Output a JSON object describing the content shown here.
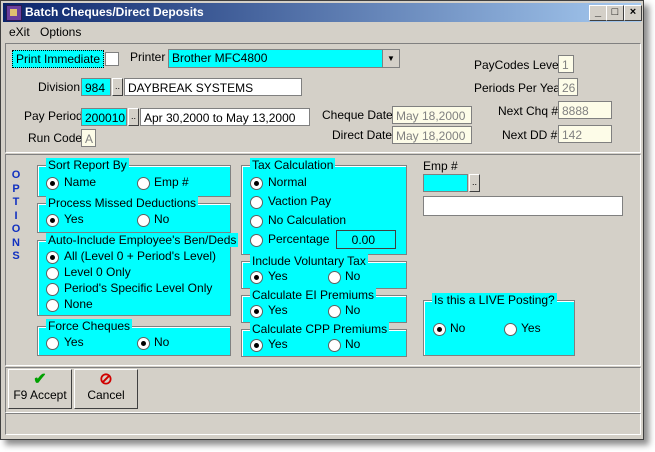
{
  "window": {
    "title": "Batch Cheques/Direct Deposits"
  },
  "menu": [
    "eXit",
    "Options"
  ],
  "top": {
    "print_immediate_label": "Print Immediate",
    "printer_label": "Printer",
    "printer_value": "Brother MFC4800",
    "division_label": "Division",
    "division_code": "984",
    "division_name": "DAYBREAK SYSTEMS",
    "pay_period_label": "Pay Period",
    "pay_period_code": "200010",
    "pay_period_range": "Apr 30,2000 to May 13,2000",
    "run_code_label": "Run Code",
    "run_code_value": "A",
    "cheque_date_label": "Cheque Date",
    "cheque_date_value": "May 18,2000",
    "direct_date_label": "Direct Date",
    "direct_date_value": "May 18,2000",
    "paycodes_level_label": "PayCodes Level",
    "paycodes_level_value": "1",
    "periods_per_year_label": "Periods Per Year",
    "periods_per_year_value": "26",
    "next_chq_label": "Next Chq #",
    "next_chq_value": "8888",
    "next_dd_label": "Next DD #",
    "next_dd_value": "142"
  },
  "options_label": "OPTIONS",
  "sort_report": {
    "title": "Sort Report By",
    "opt1": "Name",
    "opt2": "Emp #"
  },
  "missed_deductions": {
    "title": "Process Missed Deductions",
    "opt1": "Yes",
    "opt2": "No"
  },
  "auto_include": {
    "title": "Auto-Include Employee's Ben/Deds",
    "opt1": "All (Level 0 + Period's Level)",
    "opt2": "Level 0 Only",
    "opt3": "Period's Specific Level Only",
    "opt4": "None"
  },
  "force_cheques": {
    "title": "Force Cheques",
    "opt1": "Yes",
    "opt2": "No"
  },
  "tax_calc": {
    "title": "Tax Calculation",
    "opt1": "Normal",
    "opt2": "Vaction Pay",
    "opt3": "No Calculation",
    "opt4": "Percentage",
    "percentage_value": "0.00"
  },
  "voluntary_tax": {
    "title": "Include Voluntary Tax",
    "opt1": "Yes",
    "opt2": "No"
  },
  "ei_premiums": {
    "title": "Calculate EI Premiums",
    "opt1": "Yes",
    "opt2": "No"
  },
  "cpp_premiums": {
    "title": "Calculate CPP Premiums",
    "opt1": "Yes",
    "opt2": "No"
  },
  "emp": {
    "label": "Emp #",
    "code": "",
    "name": ""
  },
  "live_posting": {
    "title": "Is this a LIVE Posting?",
    "opt1": "No",
    "opt2": "Yes"
  },
  "buttons": {
    "accept": "F9 Accept",
    "cancel": "Cancel"
  },
  "colors": {
    "accent": "#00ffff",
    "title_start": "#0a246a",
    "title_end": "#a6caf0",
    "options_text": "#1030c0"
  }
}
